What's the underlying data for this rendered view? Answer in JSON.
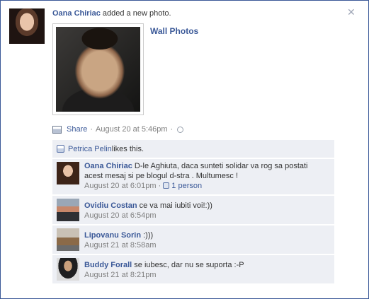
{
  "post": {
    "author": "Oana Chiriac",
    "action": " added a new photo.",
    "album_link": "Wall Photos",
    "share_label": "Share",
    "separator": " · ",
    "timestamp": "August 20 at 5:46pm",
    "separator2": " · ",
    "close_glyph": "✕"
  },
  "likes": {
    "name": "Petrica Pelin",
    "text": " likes this."
  },
  "comments": [
    {
      "author": "Oana Chiriac",
      "text": " D-le Aghiuta, daca sunteti solidar va rog sa postati acest mesaj si pe blogul d-stra . Multumesc !",
      "time": "August 20 at 6:01pm",
      "sep": " · ",
      "like_count": "1 person"
    },
    {
      "author": "Ovidiu Costan",
      "text": " ce va mai iubiti voi!:))",
      "time": "August 20 at 6:54pm"
    },
    {
      "author": "Lipovanu Sorin",
      "text": " :)))",
      "time": "August 21 at 8:58am"
    },
    {
      "author": "Buddy Forall",
      "text": " se iubesc, dar nu se suporta :-P",
      "time": "August 21 at 8:21pm"
    }
  ],
  "icons": {
    "close": "close-icon",
    "photo": "photo-icon",
    "globe": "globe-icon",
    "like": "thumbs-up-icon"
  },
  "colors": {
    "link": "#3b5998",
    "comment_bg": "#edeff4",
    "meta": "#808080"
  }
}
